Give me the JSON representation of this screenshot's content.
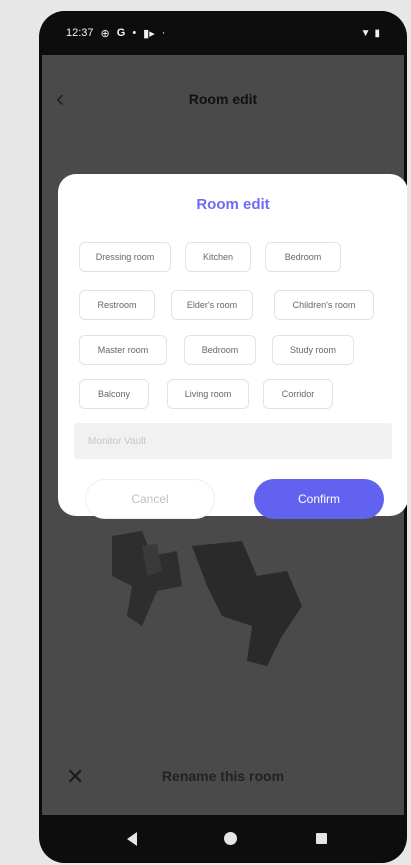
{
  "status_bar": {
    "time": "12:37",
    "icons": [
      "location-icon",
      "google-icon",
      "dot-icon",
      "cast-icon",
      "dot-icon"
    ],
    "right_icons": [
      "wifi-icon",
      "battery-icon"
    ]
  },
  "app_bar": {
    "back_icon": "chevron-left-icon",
    "title": "Room edit"
  },
  "dialog": {
    "title": "Room edit",
    "chips": [
      "Dressing room",
      "Kitchen",
      "Bedroom",
      "Restroom",
      "Elder's room",
      "Children's room",
      "Master room",
      "Bedroom",
      "Study room",
      "Balcony",
      "Living room",
      "Corridor"
    ],
    "input": {
      "placeholder": "Monitor Vault",
      "value": ""
    },
    "cancel_label": "Cancel",
    "confirm_label": "Confirm"
  },
  "bottom_bar": {
    "close_icon": "close-icon",
    "label": "Rename this room"
  },
  "nav_bar": [
    "back-icon",
    "home-icon",
    "recents-icon"
  ],
  "colors": {
    "accent": "#6262f0",
    "title_accent": "#6c6cf2",
    "overlay": "#4a4a4a"
  }
}
